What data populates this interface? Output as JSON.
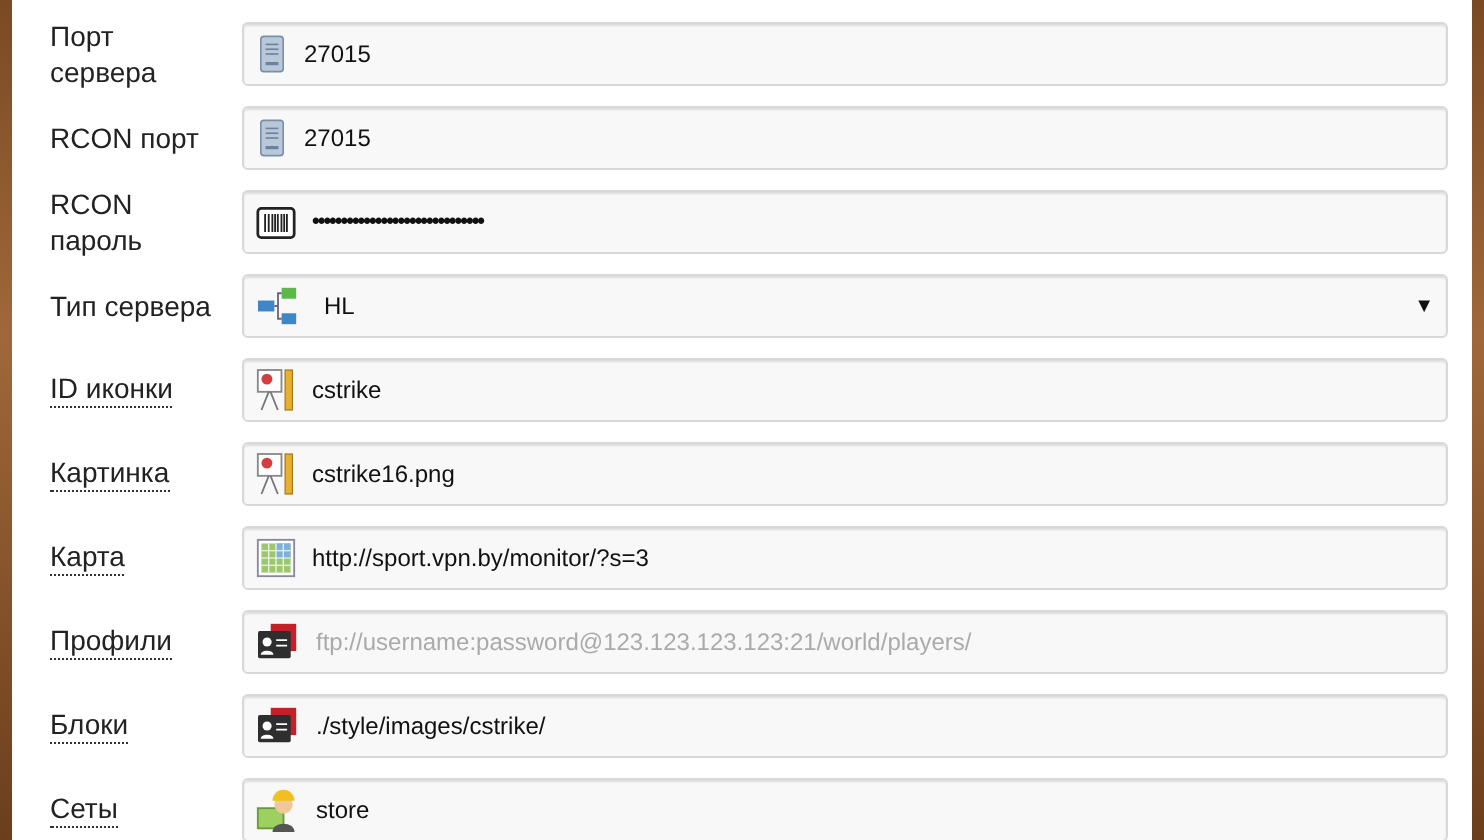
{
  "fields": [
    {
      "label": "Порт сервера",
      "underlined": false,
      "kind": "text",
      "value": "27015"
    },
    {
      "label": "RCON порт",
      "underlined": false,
      "kind": "text",
      "value": "27015"
    },
    {
      "label": "RCON пароль",
      "underlined": false,
      "kind": "password",
      "value": "••••••••••••••••••••••••••••••"
    },
    {
      "label": "Тип сервера",
      "underlined": false,
      "kind": "select",
      "value": "HL",
      "caret": "▼"
    },
    {
      "label": "ID иконки",
      "underlined": true,
      "kind": "text",
      "value": "cstrike"
    },
    {
      "label": "Картинка",
      "underlined": true,
      "kind": "text",
      "value": "cstrike16.png"
    },
    {
      "label": "Карта",
      "underlined": true,
      "kind": "text",
      "value": "http://sport.vpn.by/monitor/?s=3"
    },
    {
      "label": "Профили",
      "underlined": true,
      "kind": "text",
      "placeholder": "ftp://username:password@123.123.123.123:21/world/players/"
    },
    {
      "label": "Блоки",
      "underlined": true,
      "kind": "text",
      "value": "./style/images/cstrike/"
    },
    {
      "label": "Сеты",
      "underlined": true,
      "kind": "text",
      "value": "store"
    }
  ]
}
